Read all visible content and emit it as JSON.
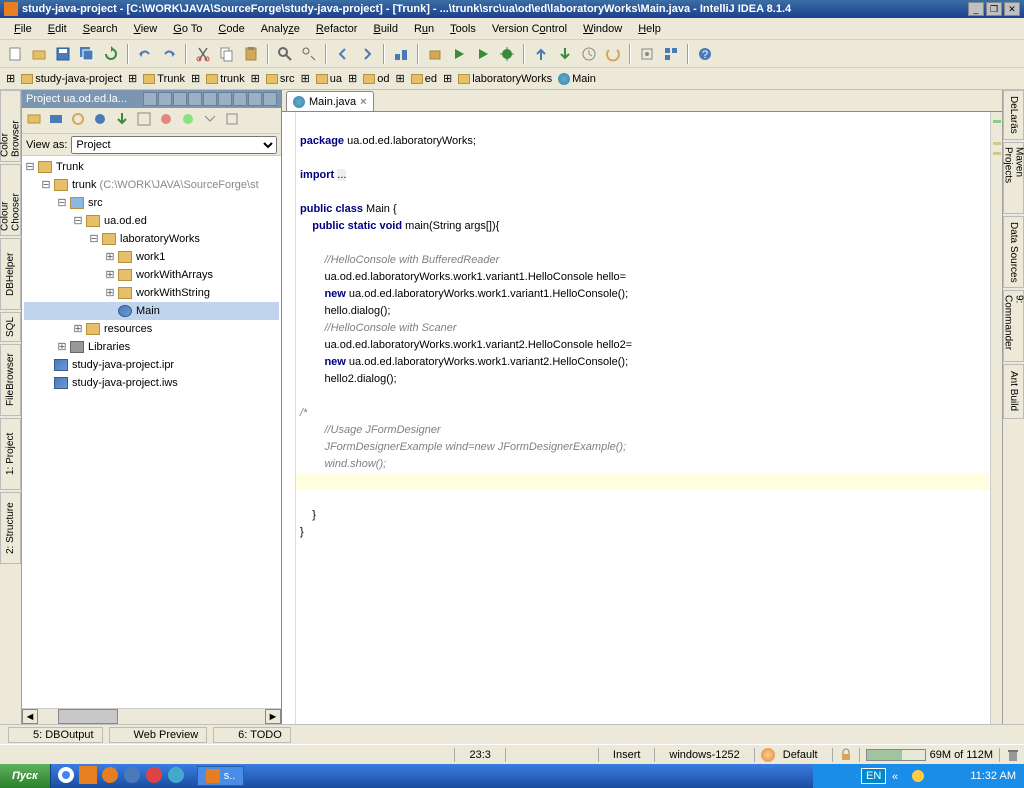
{
  "title": "study-java-project - [C:\\WORK\\JAVA\\SourceForge\\study-java-project] - [Trunk] - ...\\trunk\\src\\ua\\od\\ed\\laboratoryWorks\\Main.java - IntelliJ IDEA 8.1.4",
  "menus": [
    "File",
    "Edit",
    "Search",
    "View",
    "Go To",
    "Code",
    "Analyze",
    "Refactor",
    "Build",
    "Run",
    "Tools",
    "Version Control",
    "Window",
    "Help"
  ],
  "breadcrumb": [
    "study-java-project",
    "Trunk",
    "trunk",
    "src",
    "ua",
    "od",
    "ed",
    "laboratoryWorks",
    "Main"
  ],
  "projpane": {
    "title": "Project  ua.od.ed.la...",
    "viewas": "View as:",
    "combo": "Project"
  },
  "tree": {
    "root": "Trunk",
    "trunk": "trunk",
    "trunkpath": " (C:\\WORK\\JAVA\\SourceForge\\st",
    "src": "src",
    "pkg": "ua.od.ed",
    "lab": "laboratoryWorks",
    "w1": "work1",
    "wa": "workWithArrays",
    "ws": "workWithString",
    "main": "Main",
    "res": "resources",
    "lib": "Libraries",
    "ipr": "study-java-project.ipr",
    "iws": "study-java-project.iws"
  },
  "tab": {
    "name": "Main.java"
  },
  "code": {
    "l1": "package ua.od.ed.laboratoryWorks;",
    "l2": "import ...",
    "l3": "public class Main {",
    "l4": "    public static void main(String args[]){",
    "l5": "        //HelloConsole with BufferedReader",
    "l6": "        ua.od.ed.laboratoryWorks.work1.variant1.HelloConsole hello=",
    "l7": "        new ua.od.ed.laboratoryWorks.work1.variant1.HelloConsole();",
    "l8": "        hello.dialog();",
    "l9": "        //HelloConsole with Scaner",
    "l10": "        ua.od.ed.laboratoryWorks.work1.variant2.HelloConsole hello2=",
    "l11": "        new ua.od.ed.laboratoryWorks.work1.variant2.HelloConsole();",
    "l12": "        hello2.dialog();",
    "l13": "/*",
    "l14": "        //Usage JFormDesigner",
    "l15": "        JFormDesignerExample wind=new JFormDesignerExample();",
    "l16": "        wind.show();",
    "l17": "*/",
    "l18": "    }",
    "l19": "}"
  },
  "lefttabs": [
    "Color Browser",
    "Colour Chooser",
    "DBHelper",
    "SQL",
    "FileBrowser",
    "1: Project",
    "2: Structure"
  ],
  "righttabs": [
    "DeLaräs",
    "Maven Projects",
    "Data Sources",
    "9: Commander",
    "Ant Build"
  ],
  "bottomtabs": [
    "5: DBOutput",
    "Web Preview",
    "6: TODO"
  ],
  "status": {
    "pos": "23:3",
    "mode": "Insert",
    "enc": "windows-1252",
    "ctx": "Default",
    "mem": "69M of 112M"
  },
  "taskbar": {
    "start": "Пуск",
    "task": "s..",
    "lang": "EN",
    "time": "11:32 AM"
  }
}
